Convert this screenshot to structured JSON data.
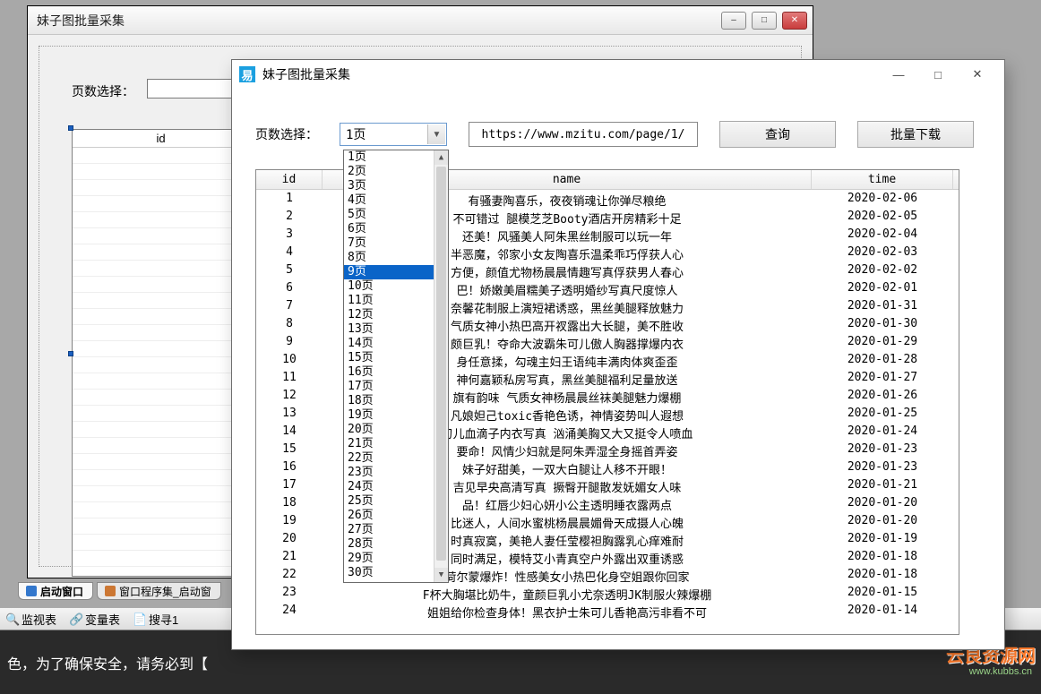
{
  "designer": {
    "title": "妹子图批量采集",
    "page_label": "页数选择：",
    "table_col": "id",
    "tabs": [
      "启动窗口",
      "窗口程序集_启动窗"
    ],
    "tools": [
      "监视表",
      "变量表",
      "搜寻1"
    ]
  },
  "ide_status": "色，为了确保安全，请务必到【",
  "logo_text": "云良资源网",
  "logo_url": "www.kubbs.cn",
  "runtime": {
    "title": "妹子图批量采集",
    "page_label": "页数选择：",
    "combo_value": "1页",
    "combo_options": [
      "1页",
      "2页",
      "3页",
      "4页",
      "5页",
      "6页",
      "7页",
      "8页",
      "9页",
      "10页",
      "11页",
      "12页",
      "13页",
      "14页",
      "15页",
      "16页",
      "17页",
      "18页",
      "19页",
      "20页",
      "21页",
      "22页",
      "23页",
      "24页",
      "25页",
      "26页",
      "27页",
      "28页",
      "29页",
      "30页"
    ],
    "combo_selected_index": 8,
    "url": "https://www.mzitu.com/page/1/",
    "query_btn": "查询",
    "batch_btn": "批量下载",
    "columns": [
      "id",
      "name",
      "time"
    ],
    "rows": [
      {
        "id": "1",
        "name": "有骚妻陶喜乐，夜夜销魂让你弹尽粮绝",
        "time": "2020-02-06"
      },
      {
        "id": "2",
        "name": "不可错过 腿模芝芝Booty酒店开房精彩十足",
        "time": "2020-02-05"
      },
      {
        "id": "3",
        "name": "还美！风骚美人阿朱黑丝制服可以玩一年",
        "time": "2020-02-04"
      },
      {
        "id": "4",
        "name": "半恶魔，邻家小女友陶喜乐温柔乖巧俘获人心",
        "time": "2020-02-03"
      },
      {
        "id": "5",
        "name": "方便，颜值尤物杨晨晨情趣写真俘获男人春心",
        "time": "2020-02-02"
      },
      {
        "id": "6",
        "name": "巴！娇嫩美眉糯美子透明婚纱写真尺度惊人",
        "time": "2020-02-01"
      },
      {
        "id": "7",
        "name": "奈馨花制服上演短裙诱惑，黑丝美腿释放魅力",
        "time": "2020-01-31"
      },
      {
        "id": "8",
        "name": "气质女神小热巴高开衩露出大长腿，美不胜收",
        "time": "2020-01-30"
      },
      {
        "id": "9",
        "name": "颇巨乳！夺命大波霸朱可儿傲人胸器撑爆内衣",
        "time": "2020-01-29"
      },
      {
        "id": "10",
        "name": "身任意揉，勾魂主妇王语纯丰满肉体爽歪歪",
        "time": "2020-01-28"
      },
      {
        "id": "11",
        "name": "神何嘉颖私房写真，黑丝美腿福利足量放送",
        "time": "2020-01-27"
      },
      {
        "id": "12",
        "name": "旗有韵味 气质女神杨晨晨丝袜美腿魅力爆棚",
        "time": "2020-01-26"
      },
      {
        "id": "13",
        "name": "凡娘妲己toxic香艳色诱，神情姿势叫人遐想",
        "time": "2020-01-25"
      },
      {
        "id": "14",
        "name": "刃儿血滴子内衣写真 汹涌美胸又大又挺令人喷血",
        "time": "2020-01-24"
      },
      {
        "id": "15",
        "name": "要命！风情少妇就是阿朱弄湿全身摇首弄姿",
        "time": "2020-01-23"
      },
      {
        "id": "16",
        "name": "妹子好甜美，一双大白腿让人移不开眼！",
        "time": "2020-01-23"
      },
      {
        "id": "17",
        "name": "吉见早央高清写真 撅臀开腿散发妩媚女人味",
        "time": "2020-01-21"
      },
      {
        "id": "18",
        "name": "品！红唇少妇心妍小公主透明睡衣露两点",
        "time": "2020-01-20"
      },
      {
        "id": "19",
        "name": "比迷人，人间水蜜桃杨晨晨媚骨天成摄人心魄",
        "time": "2020-01-20"
      },
      {
        "id": "20",
        "name": "时真寂寞，美艳人妻任莹樱袒胸露乳心痒难耐",
        "time": "2020-01-19"
      },
      {
        "id": "21",
        "name": "同时满足，模特艾小青真空户外露出双重诱惑",
        "time": "2020-01-18"
      },
      {
        "id": "22",
        "name": "荷尔蒙爆炸！性感美女小热巴化身空姐跟你回家",
        "time": "2020-01-18"
      },
      {
        "id": "23",
        "name": "F杯大胸堪比奶牛，童颜巨乳小尤奈透明JK制服火辣爆棚",
        "time": "2020-01-15"
      },
      {
        "id": "24",
        "name": "姐姐给你检查身体！黑衣护士朱可儿香艳高污非看不可",
        "time": "2020-01-14"
      }
    ]
  }
}
